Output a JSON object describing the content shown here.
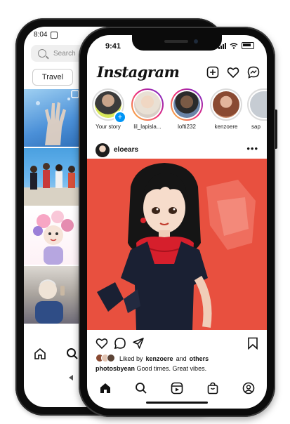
{
  "back_phone": {
    "status_time": "8:04",
    "search": {
      "placeholder": "Search"
    },
    "chip_label": "Travel"
  },
  "front_phone": {
    "status_time": "9:41",
    "app_title": "Instagram",
    "stories": [
      {
        "label": "Your story",
        "ring": "none",
        "avatar_color": "#3b3b3b",
        "has_add_badge": true
      },
      {
        "label": "lil_lapisla...",
        "ring": "gradient",
        "avatar_color": "#e7d7c9"
      },
      {
        "label": "lofti232",
        "ring": "gradient",
        "avatar_color": "#5a4a3e"
      },
      {
        "label": "kenzoere",
        "ring": "none",
        "avatar_color": "#8a4a32"
      },
      {
        "label": "sap",
        "ring": "none",
        "avatar_color": "#c6ccd3"
      }
    ],
    "post": {
      "username": "eloears",
      "more_icon": "more-horizontal-icon",
      "image_bg": "#e8503f",
      "liked_by_prefix": "Liked by",
      "liked_by_user": "kenzoere",
      "liked_by_connector": "and",
      "liked_by_suffix": "others",
      "caption_user": "photosbyean",
      "caption_text": "Good times. Great vibes."
    },
    "nav_icons": [
      "home-icon",
      "search-icon",
      "reels-icon",
      "shop-icon",
      "profile-icon"
    ]
  },
  "colors": {
    "accent_blue": "#0095f6",
    "post_background": "#e8503f",
    "phone_frame": "#0b0b0b"
  }
}
